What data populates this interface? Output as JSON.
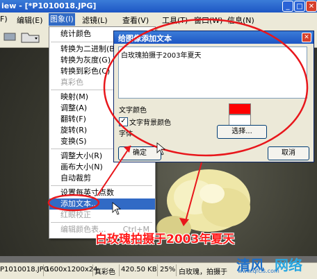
{
  "window": {
    "title_fragment": "iew - [*P1010018.JPG]",
    "buttons": {
      "minimize": "_",
      "maximize": "□",
      "close": "✕"
    }
  },
  "menubar": {
    "items": [
      {
        "label": "F)"
      },
      {
        "label": "编辑(E)"
      },
      {
        "label": "图象(I)"
      },
      {
        "label": "滤镜(L)"
      },
      {
        "label": "查看(V)"
      },
      {
        "label": "工具(T)"
      },
      {
        "label": "窗口(W)"
      },
      {
        "label": "信息(N)"
      }
    ]
  },
  "dropdown": {
    "items": [
      {
        "label": "统计颜色",
        "shortcut": "",
        "disabled": false
      },
      {
        "label": "转换为二进制(B)",
        "shortcut": "",
        "disabled": false
      },
      {
        "label": "转换为灰度(G)",
        "shortcut": "",
        "disabled": false
      },
      {
        "label": "转换到彩色(C)",
        "shortcut": "",
        "disabled": false
      },
      {
        "label": "真彩色",
        "shortcut": "",
        "disabled": true
      },
      {
        "label": "映射(M)",
        "shortcut": "",
        "disabled": false
      },
      {
        "label": "调整(A)",
        "shortcut": "",
        "disabled": false
      },
      {
        "label": "翻转(F)",
        "shortcut": "",
        "disabled": false
      },
      {
        "label": "旋转(R)",
        "shortcut": "",
        "disabled": false
      },
      {
        "label": "变换(S)",
        "shortcut": "",
        "disabled": false
      },
      {
        "label": "调整大小(R)",
        "shortcut": "",
        "disabled": false
      },
      {
        "label": "画布大小(N)",
        "shortcut": "",
        "disabled": false
      },
      {
        "label": "自动裁剪",
        "shortcut": "",
        "disabled": false
      },
      {
        "label": "设置每英寸点数",
        "shortcut": "",
        "disabled": false
      },
      {
        "label": "添加文本...",
        "shortcut": "",
        "disabled": false,
        "highlighted": true
      },
      {
        "label": "红眼校正",
        "shortcut": "",
        "disabled": true
      },
      {
        "label": "编辑颜色表...",
        "shortcut": "Ctrl+M",
        "disabled": true
      }
    ]
  },
  "dialog": {
    "title": "给图像添加文本",
    "text_value": "白玫瑰拍摄于2003年夏天",
    "text_color_label": "文字颜色",
    "bg_color_label": "文字背景颜色",
    "font_label": "字体",
    "select_button": "选择...",
    "ok_button": "确定",
    "cancel_button": "取消",
    "bg_checked": true
  },
  "status": {
    "filename": "P1010018.JPG",
    "dimensions": "1600x1200x24",
    "color_mode": "真彩色",
    "filesize": "420.50 KB",
    "zoom": "25%",
    "extra": "白玫瑰，拍摄于"
  },
  "annotations": {
    "caption": "白玫瑰拍摄于2003年夏天",
    "watermark_a": "清风",
    "watermark_b": "网络",
    "watermark_url": "www.qfcis.com"
  },
  "colors": {
    "text_color": "#ff0000",
    "text_bg_color": "#ffffff",
    "highlight": "#316ac5",
    "annotation_red": "#e8161b"
  }
}
